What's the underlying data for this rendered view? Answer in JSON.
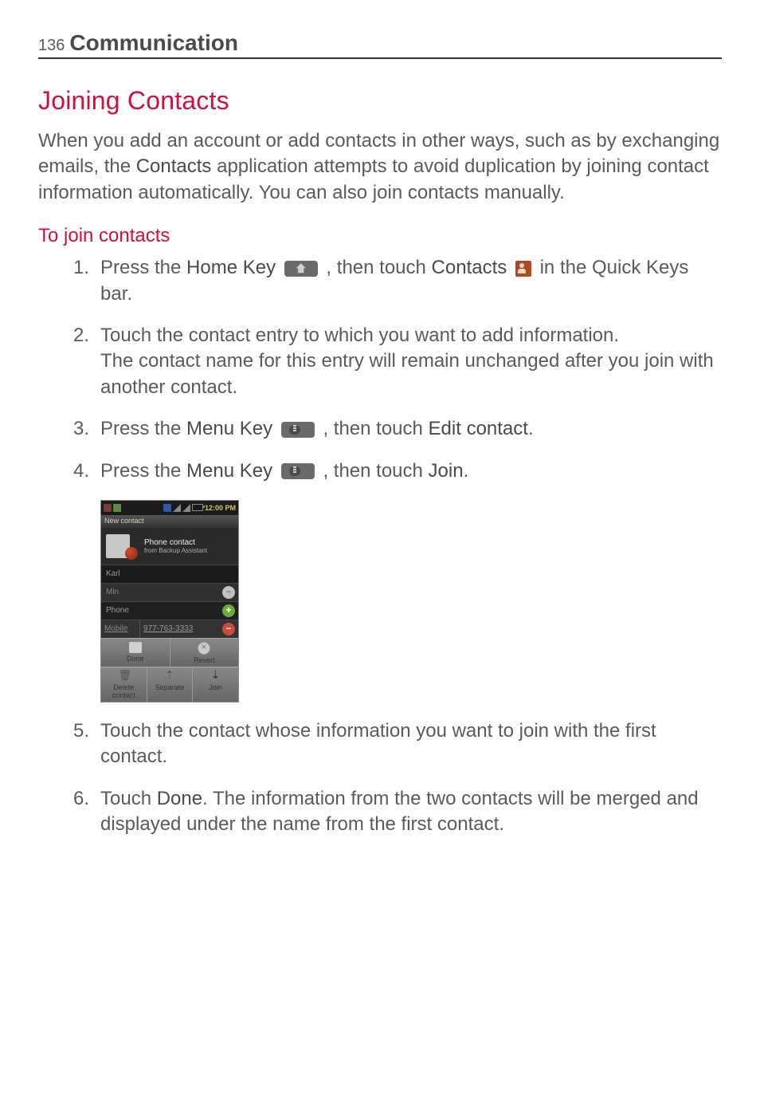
{
  "header": {
    "page_number": "136",
    "section": "Communication"
  },
  "h2": "Joining Contacts",
  "intro": "When you add an account or add contacts in other ways, such as by exchanging emails, the Contacts application attempts to avoid duplication by joining contact information automatically. You can also join contacts manually.",
  "intro_parts": {
    "a": "When you add an account or add contacts in other ways, such as by exchanging emails, the ",
    "b": "Contacts",
    "c": " application attempts to avoid duplication by joining contact information automatically. You can also join contacts manually."
  },
  "h3": "To join contacts",
  "steps": [
    {
      "num": "1.",
      "parts": {
        "a": " Press the ",
        "b": "Home Key",
        "c": " , then touch ",
        "d": "Contacts",
        "e": " in the Quick Keys bar."
      }
    },
    {
      "num": "2.",
      "parts": {
        "a": "Touch the contact entry to which you want to add information.",
        "b": "The contact name for this entry will remain unchanged after you join with another contact."
      }
    },
    {
      "num": "3.",
      "parts": {
        "a": " Press the ",
        "b": "Menu Key",
        "c": " , then touch ",
        "d": "Edit contact",
        "e": "."
      }
    },
    {
      "num": "4.",
      "parts": {
        "a": " Press the ",
        "b": "Menu Key",
        "c": " , then touch ",
        "d": "Join",
        "e": "."
      }
    },
    {
      "num": "5.",
      "parts": {
        "a": "Touch the contact whose information you want to join with the first contact."
      }
    },
    {
      "num": "6.",
      "parts": {
        "a": "Touch ",
        "b": "Done",
        "c": ". The information from the two contacts will be merged and displayed under the name from the first contact."
      }
    }
  ],
  "screenshot": {
    "time": "12:00 PM",
    "topbar": "New contact",
    "header_title": "Phone contact",
    "header_sub": "from Backup Assistant",
    "field_name": "Karl",
    "field_min": "Min",
    "section_phone": "Phone",
    "phone_label": "Mobile",
    "phone_value": "977-763-3333",
    "btn_done": "Done",
    "btn_revert": "Revert",
    "btn_delete": "Delete contact",
    "btn_separate": "Separate",
    "btn_join": "Join"
  }
}
